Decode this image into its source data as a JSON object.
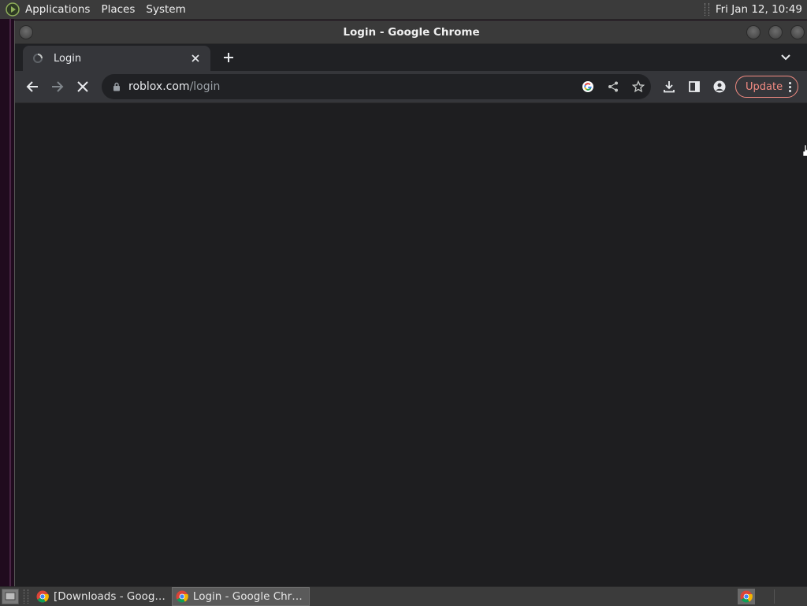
{
  "top_panel": {
    "menus": [
      "Applications",
      "Places",
      "System"
    ],
    "clock": "Fri Jan 12, 10:49"
  },
  "window": {
    "title": "Login - Google Chrome"
  },
  "tabs": [
    {
      "title": "Login",
      "loading": true
    }
  ],
  "toolbar": {
    "url_host": "roblox.com",
    "url_path": "/login",
    "update_label": "Update"
  },
  "taskbar": {
    "items": [
      {
        "label": "[Downloads - Goog…",
        "active": false
      },
      {
        "label": "Login - Google Chr…",
        "active": true
      }
    ]
  },
  "colors": {
    "panel": "#3b3b3b",
    "tab_active": "#35363a",
    "tabstrip": "#202124",
    "content_bg": "#1e1e20",
    "update_accent": "#f28b82"
  }
}
